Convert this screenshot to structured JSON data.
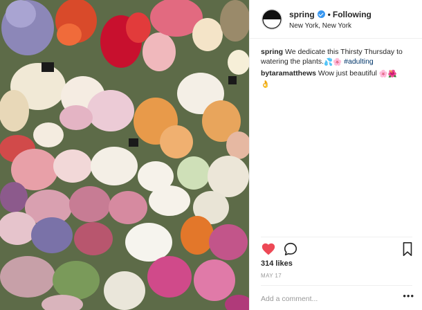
{
  "post": {
    "author": {
      "handle": "spring",
      "verified": true,
      "follow_status": "Following",
      "location": "New York, New York"
    },
    "image": {
      "description_icon": "flowers-photo",
      "colors": {
        "background": "#6b7a55",
        "pink": "#e8a0a8",
        "white": "#f4efe6",
        "red": "#c8102e",
        "orange": "#e89a4a",
        "lavender": "#8c87b8"
      }
    },
    "comments": [
      {
        "user": "spring",
        "text": "We dedicate this Thirsty Thursday to watering the plants.",
        "emojis": [
          "💦",
          "🌸"
        ],
        "hashtag": "#adulting"
      },
      {
        "user": "bytaramatthews",
        "text": "Wow just beautiful",
        "emojis": [
          "🌸",
          "🌺",
          "👌"
        ]
      }
    ],
    "actions": {
      "like_icon": "heart-filled-icon",
      "comment_icon": "comment-bubble-icon",
      "save_icon": "bookmark-icon",
      "liked": true,
      "like_color": "#ed4956"
    },
    "likes_text": "314 likes",
    "date": "MAY 17",
    "add_comment": {
      "placeholder": "Add a comment...",
      "more_label": "•••"
    }
  }
}
